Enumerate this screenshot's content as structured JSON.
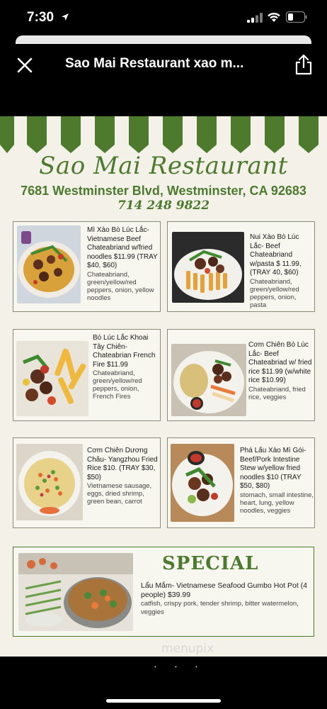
{
  "status_bar": {
    "time": "7:30"
  },
  "nav": {
    "title": "Sao Mai Restaurant xao m..."
  },
  "menu": {
    "restaurant_name": "Sao Mai Restaurant",
    "address": "7681 Westminster Blvd, Westminster, CA 92683",
    "phone": "714 248 9822",
    "items": [
      {
        "title": "Mì Xào Bò Lúc Lắc- Vietnamese Beef Chateabriand w/fried noodles $11.99 (TRAY $40, $60)",
        "description": "Chateabriand, green/yellow/red peppers, onion, yellow noodles"
      },
      {
        "title": "Nui Xào Bò Lúc Lắc- Beef Chateabriand w/pasta $ 11.99, (TRAY 40, $60)",
        "description": "Chateabriand, green/yellow/red peppers, onion, pasta"
      },
      {
        "title": "Bò Lúc Lắc Khoai Tây Chiên- Chateabrian French Fire $11.99",
        "description": "Chateabriand, green/yellow/red peppers, onion, French Fires"
      },
      {
        "title": "Cơm Chiên Bò Lúc Lắc- Beef Chateabriad w/ fried rice $11.99 (w/white rice $10.99)",
        "description": "Chateabriand, fried rice, veggies"
      },
      {
        "title": "Cơm Chiên Dương Châu- Yangzhou Fried Rice $10. (TRAY $30, $50)",
        "description": "Vietnamese sausage, eggs, dried shrimp, green bean, carrot"
      },
      {
        "title": "Phá Lấu Xào Mì Gói- Beef/Pork Intestine Stew w/yellow fried noodles $10 (TRAY $50, $80)",
        "description": "stomach, small intestine, heart, lung, yellow noodles, veggies"
      }
    ],
    "special": {
      "label": "SPECIAL",
      "title": "Lẩu Mắm- Vietnamese Seafood Gumbo Hot Pot (4 people)  $39.99",
      "description": "catfish, crispy pork, tender shrimp, bitter watermelon, veggies"
    },
    "watermark": "menupix"
  },
  "icons": {
    "location": "location-arrow-icon",
    "signal": "signal-icon",
    "wifi": "wifi-icon",
    "battery": "battery-icon",
    "close": "close-icon",
    "share": "share-icon"
  },
  "colors": {
    "brand_green": "#4d7a2f",
    "awning_green": "#4e7a2e",
    "flyer_bg": "#f3f1e8"
  }
}
